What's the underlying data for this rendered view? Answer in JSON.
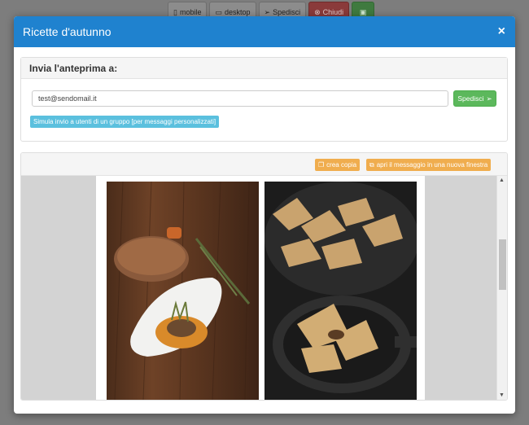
{
  "toolbar": {
    "mobile_label": "mobile",
    "desktop_label": "desktop",
    "send_label": "Spedisci",
    "close_label": "Chiudi"
  },
  "modal": {
    "title": "Ricette d'autunno",
    "close_symbol": "×"
  },
  "preview_send": {
    "heading": "Invia l'anteprima a:",
    "email_value": "test@sendomail.it",
    "send_button_label": "Spedisci",
    "simulate_label": "Simula invio a utenti di un gruppo [per messaggi personalizzati]"
  },
  "message_preview": {
    "copy_label": "crea copia",
    "open_new_window_label": "apri il messaggio in una nuova finestra"
  },
  "colors": {
    "header": "#1f82cf",
    "success": "#5cb85c",
    "info": "#5bc0de",
    "warning": "#f0ad4e",
    "danger": "#d9534f"
  }
}
